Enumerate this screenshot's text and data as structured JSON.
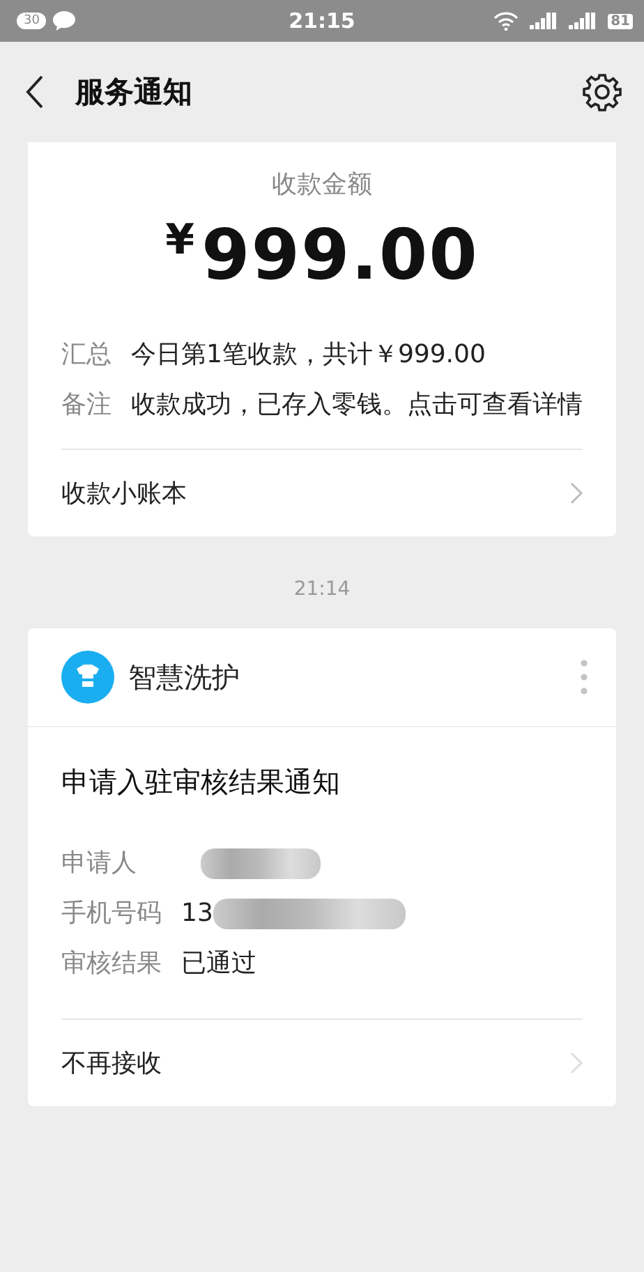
{
  "status_bar": {
    "notification_count": "30",
    "time": "21:15",
    "battery": "81"
  },
  "header": {
    "title": "服务通知"
  },
  "payment_card": {
    "caption": "收款金额",
    "currency": "¥",
    "amount": "999.00",
    "rows": [
      {
        "label": "汇总",
        "value": "今日第1笔收款，共计￥999.00"
      },
      {
        "label": "备注",
        "value": "收款成功，已存入零钱。点击可查看详情"
      }
    ],
    "link": "收款小账本"
  },
  "timestamp": "21:14",
  "review_card": {
    "sender": "智慧洗护",
    "title": "申请入驻审核结果通知",
    "rows": [
      {
        "label": "申请人",
        "redacted": true
      },
      {
        "label": "手机号码",
        "value": "13",
        "redacted": true
      },
      {
        "label": "审核结果",
        "value": "已通过",
        "redacted": false
      }
    ],
    "link": "不再接收"
  }
}
